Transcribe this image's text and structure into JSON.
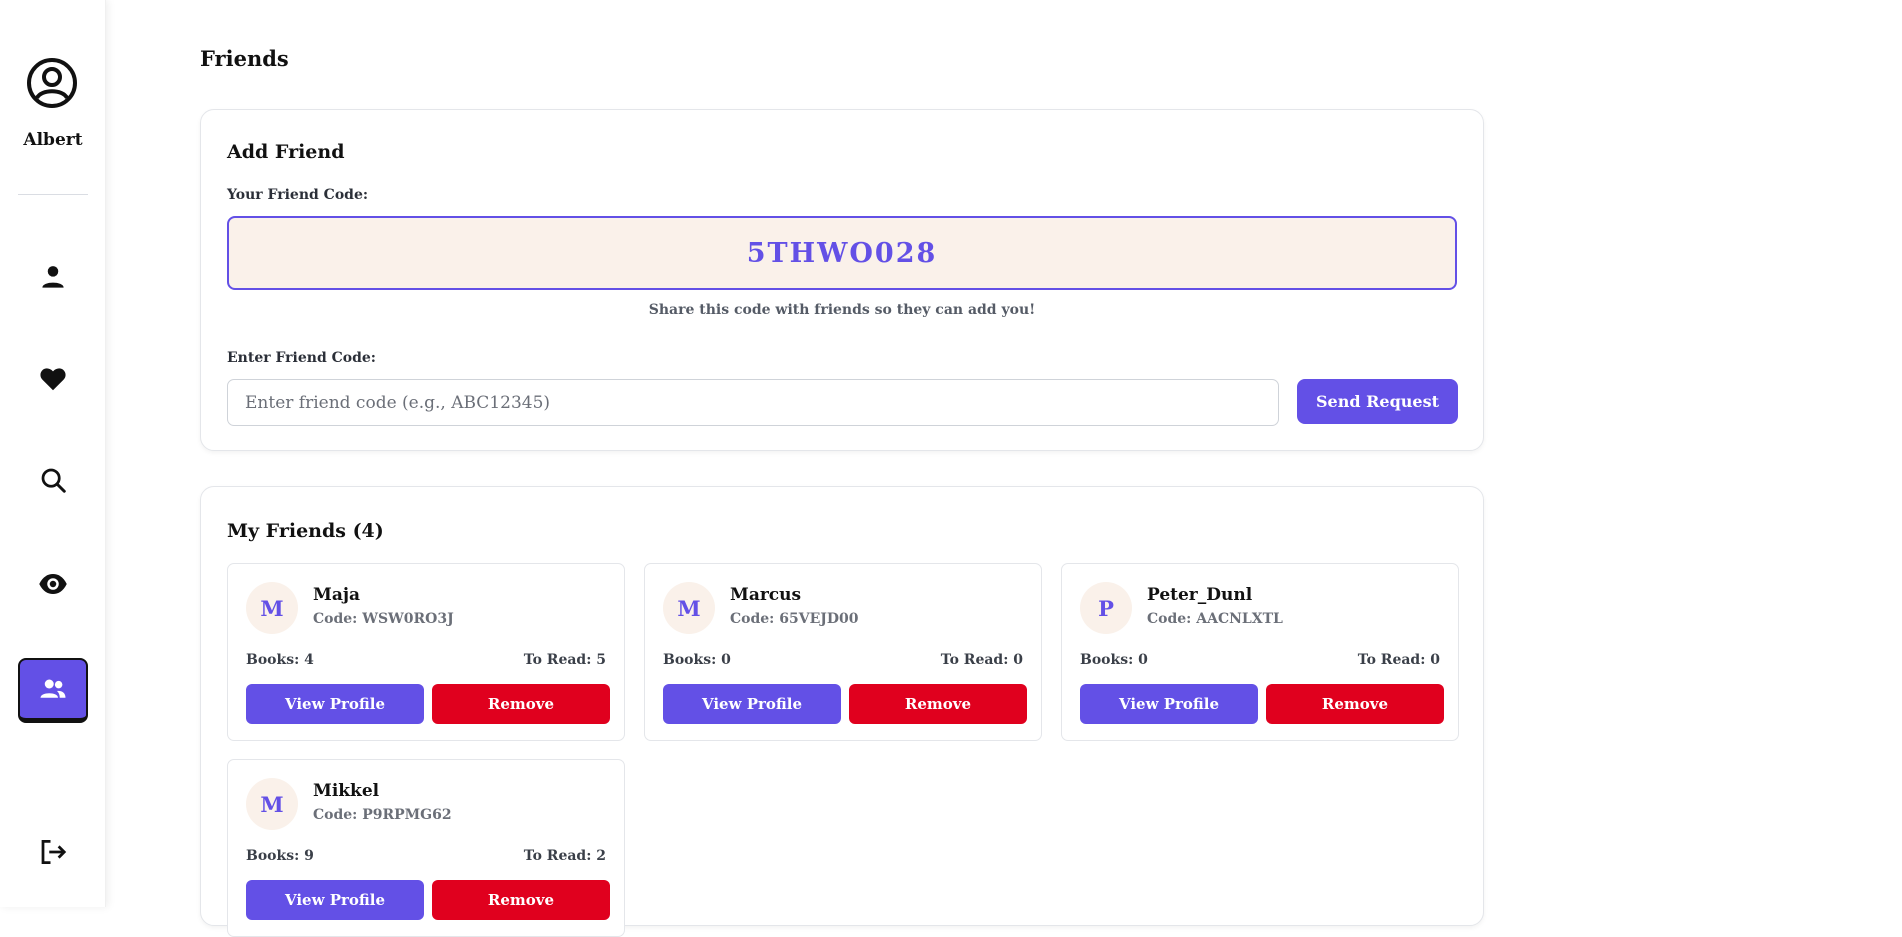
{
  "sidebar": {
    "user_name": "Albert",
    "avatar_icon": "user-circle-icon",
    "nav": [
      {
        "icon": "person-icon",
        "active": false
      },
      {
        "icon": "heart-icon",
        "active": false
      },
      {
        "icon": "search-icon",
        "active": false
      },
      {
        "icon": "eye-icon",
        "active": false
      },
      {
        "icon": "friends-icon",
        "active": true
      },
      {
        "icon": "logout-icon",
        "active": false
      }
    ]
  },
  "page": {
    "title": "Friends"
  },
  "add_friend": {
    "title": "Add Friend",
    "your_code_label": "Your Friend Code:",
    "your_code": "5THWO028",
    "share_hint": "Share this code with friends so they can add you!",
    "enter_label": "Enter Friend Code:",
    "input_placeholder": "Enter friend code (e.g., ABC12345)",
    "input_value": "",
    "send_label": "Send Request"
  },
  "friends": {
    "title": "My Friends (4)",
    "view_label": "View Profile",
    "remove_label": "Remove",
    "list": [
      {
        "initial": "M",
        "name": "Maja",
        "code": "Code: WSW0RO3J",
        "books": "Books: 4",
        "to_read": "To Read: 5"
      },
      {
        "initial": "M",
        "name": "Marcus",
        "code": "Code: 65VEJD00",
        "books": "Books: 0",
        "to_read": "To Read: 0"
      },
      {
        "initial": "P",
        "name": "Peter_Dunl",
        "code": "Code: AACNLXTL",
        "books": "Books: 0",
        "to_read": "To Read: 0"
      },
      {
        "initial": "M",
        "name": "Mikkel",
        "code": "Code: P9RPMG62",
        "books": "Books: 9",
        "to_read": "To Read: 2"
      }
    ]
  },
  "colors": {
    "accent": "#6350e6",
    "danger": "#e0001e",
    "code_bg": "#faf1ea"
  }
}
